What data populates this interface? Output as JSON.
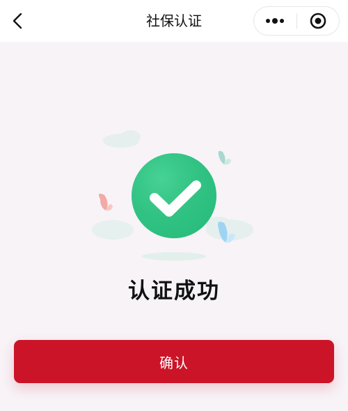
{
  "header": {
    "title": "社保认证",
    "back_icon": "chevron-left-icon",
    "menu_icon": "more-dots-icon",
    "close_icon": "target-close-icon"
  },
  "status": {
    "icon": "check-circle-icon",
    "text": "认证成功"
  },
  "actions": {
    "confirm_label": "确认"
  },
  "colors": {
    "primary": "#cc1428",
    "success": "#2cc281",
    "background": "#f7f3f7",
    "header_bg": "#ffffff"
  }
}
